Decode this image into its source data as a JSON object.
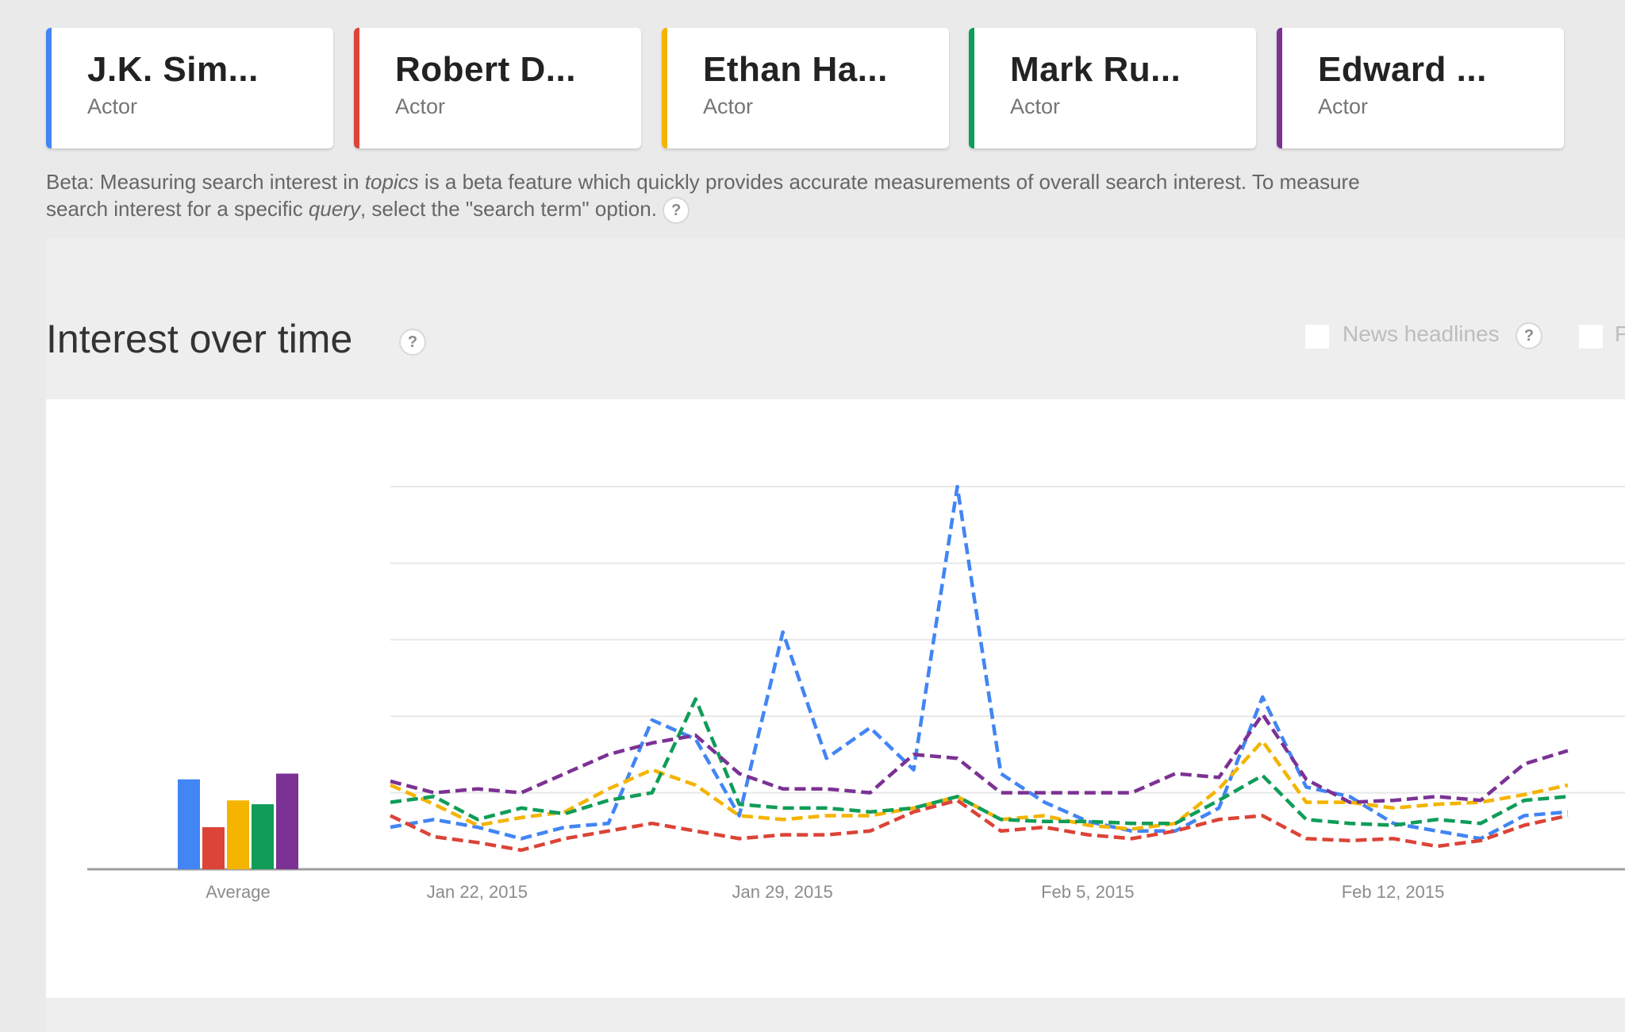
{
  "cards": [
    {
      "title": "J.K. Sim...",
      "subtitle": "Actor",
      "color": "#4285f4"
    },
    {
      "title": "Robert D...",
      "subtitle": "Actor",
      "color": "#db4437"
    },
    {
      "title": "Ethan Ha...",
      "subtitle": "Actor",
      "color": "#f4b400"
    },
    {
      "title": "Mark Ru...",
      "subtitle": "Actor",
      "color": "#0f9d58"
    },
    {
      "title": "Edward ...",
      "subtitle": "Actor",
      "color": "#7b3294"
    }
  ],
  "beta_note": {
    "part1": "Beta: Measuring search interest in ",
    "em1": "topics",
    "part2": " is a beta feature which quickly provides accurate measurements of overall search interest. To measure search interest for a specific ",
    "em2": "query",
    "part3": ", select the \"search term\" option.",
    "help": "?"
  },
  "section": {
    "title": "Interest over time",
    "help": "?",
    "options": [
      {
        "label": "News headlines",
        "checked": false,
        "help": "?"
      },
      {
        "label": "F",
        "checked": false
      }
    ]
  },
  "chart_data": {
    "type": "line",
    "title": "Interest over time",
    "xlabel": "",
    "ylabel": "",
    "ylim": [
      0,
      100
    ],
    "gridlines": [
      20,
      40,
      60,
      80,
      100
    ],
    "grid": true,
    "line_style": "dashed",
    "x_tick_labels": [
      {
        "label": "Jan 22, 2015",
        "index": 2.5
      },
      {
        "label": "Jan 29, 2015",
        "index": 9.5
      },
      {
        "label": "Feb 5, 2015",
        "index": 16.5
      },
      {
        "label": "Feb 12, 2015",
        "index": 23.5
      }
    ],
    "average": {
      "label": "Average",
      "values": [
        23.5,
        11,
        18,
        17,
        25
      ]
    },
    "series": [
      {
        "name": "J.K. Sim...",
        "color": "#4285f4",
        "values": [
          11,
          13,
          11,
          8,
          11,
          12,
          39,
          34,
          14,
          62,
          29,
          37,
          26,
          100,
          25,
          17.5,
          12.5,
          10,
          10,
          16,
          45,
          21.5,
          19,
          12,
          10,
          8,
          14,
          15
        ]
      },
      {
        "name": "Robert D...",
        "color": "#db4437",
        "values": [
          14,
          8.5,
          7,
          5,
          8,
          10,
          12,
          10,
          8,
          9,
          9,
          10,
          15,
          18,
          10,
          11,
          9,
          8,
          10,
          13,
          14,
          8,
          7.5,
          8,
          6,
          7.5,
          11.5,
          14
        ]
      },
      {
        "name": "Ethan Ha...",
        "color": "#f4b400",
        "values": [
          22,
          17,
          11.5,
          13.5,
          15,
          21,
          26,
          22,
          14,
          13,
          14,
          14,
          16,
          19,
          13,
          14,
          11.5,
          10.5,
          12,
          21,
          33.5,
          17.5,
          17.5,
          16,
          17,
          17.5,
          19.5,
          22
        ]
      },
      {
        "name": "Mark Ru...",
        "color": "#0f9d58",
        "values": [
          17.5,
          19,
          13,
          16,
          14.5,
          18,
          20,
          44.5,
          17,
          16,
          16,
          15,
          16,
          19,
          13,
          12.5,
          12.5,
          12,
          12,
          18,
          24.5,
          13,
          12,
          11.5,
          13,
          12,
          18,
          19
        ]
      },
      {
        "name": "Edward ...",
        "color": "#7b3294",
        "values": [
          23,
          20,
          21,
          20,
          25,
          30,
          33,
          35,
          25,
          21,
          21,
          20,
          30,
          29,
          20,
          20,
          20,
          20,
          25,
          24,
          40.5,
          23.5,
          17.5,
          18,
          19,
          18,
          27.5,
          31
        ]
      }
    ]
  }
}
